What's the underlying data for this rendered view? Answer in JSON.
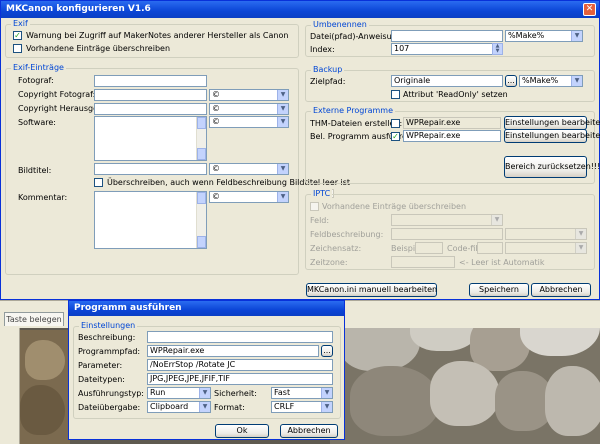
{
  "main": {
    "title": "MKCanon konfigurieren V1.6",
    "exif": {
      "group": "Exif",
      "warn_label": "Warnung bei Zugriff auf MakerNotes anderer Hersteller als Canon",
      "overwrite_label": "Vorhandene Einträge überschreiben"
    },
    "entries": {
      "group": "Exif-Einträge",
      "fotograf": "Fotograf:",
      "copyright_foto": "Copyright Fotograf:",
      "copyright_hrsg": "Copyright Herausgeber:",
      "software": "Software:",
      "bildtitel": "Bildtitel:",
      "overwrite_title_label": "Überschreiben, auch wenn Feldbeschreibung Bildtitel leer ist",
      "kommentar": "Kommentar:",
      "select_value": "©"
    },
    "rename": {
      "group": "Umbenennen",
      "datei_label": "Datei(pfad)-Anweisungen:",
      "datei_value": "%Make%",
      "index_label": "Index:",
      "index_value": "107"
    },
    "backup": {
      "group": "Backup",
      "ziel_label": "Zielpfad:",
      "ziel_value": "Originale",
      "browse": "...",
      "ziel_select": "%Make%",
      "readonly_label": "Attribut 'ReadOnly' setzen"
    },
    "external": {
      "group": "Externe Programme",
      "thm_label": "THM-Dateien erstellen:",
      "thm_value": "WPRepair.exe",
      "bel_label": "Bel. Programm ausführen:",
      "bel_value": "WPRepair.exe",
      "settings_btn": "Einstellungen bearbeiten...",
      "reset_btn": "Bereich zurücksetzen!!!"
    },
    "iptc": {
      "group": "IPTC",
      "overwrite_label": "Vorhandene Einträge überschreiben",
      "feld": "Feld:",
      "feldbeschreibung": "Feldbeschreibung:",
      "zeichensatz": "Zeichensatz:",
      "example": "Beispiel:",
      "codefile": "Code-file:",
      "zeitzone": "Zeitzone:",
      "auto_hint": "<- Leer ist Automatik"
    },
    "buttons": {
      "ini": "MKCanon.ini manuell bearbeiten",
      "save": "Speichern",
      "cancel": "Abbrechen"
    }
  },
  "background": {
    "tab_label": "Taste belegen"
  },
  "dialog": {
    "title": "Programm ausführen",
    "group": "Einstellungen",
    "beschreibung_label": "Beschreibung:",
    "beschreibung_value": "",
    "programmpfad_label": "Programmpfad:",
    "programmpfad_value": "WPRepair.exe",
    "browse": "...",
    "parameter_label": "Parameter:",
    "parameter_value": "/NoErrStop /Rotate JC",
    "dateitypen_label": "Dateitypen:",
    "dateitypen_value": "JPG,JPEG,JPE,JFIF,TIF",
    "ausfuehrung_label": "Ausführungstyp:",
    "ausfuehrung_value": "Run",
    "sicherheit_label": "Sicherheit:",
    "sicherheit_value": "Fast",
    "dateiuebergabe_label": "Dateiübergabe:",
    "dateiuebergabe_value": "Clipboard",
    "format_label": "Format:",
    "format_value": "CRLF",
    "ok": "Ok",
    "cancel": "Abbrechen"
  }
}
